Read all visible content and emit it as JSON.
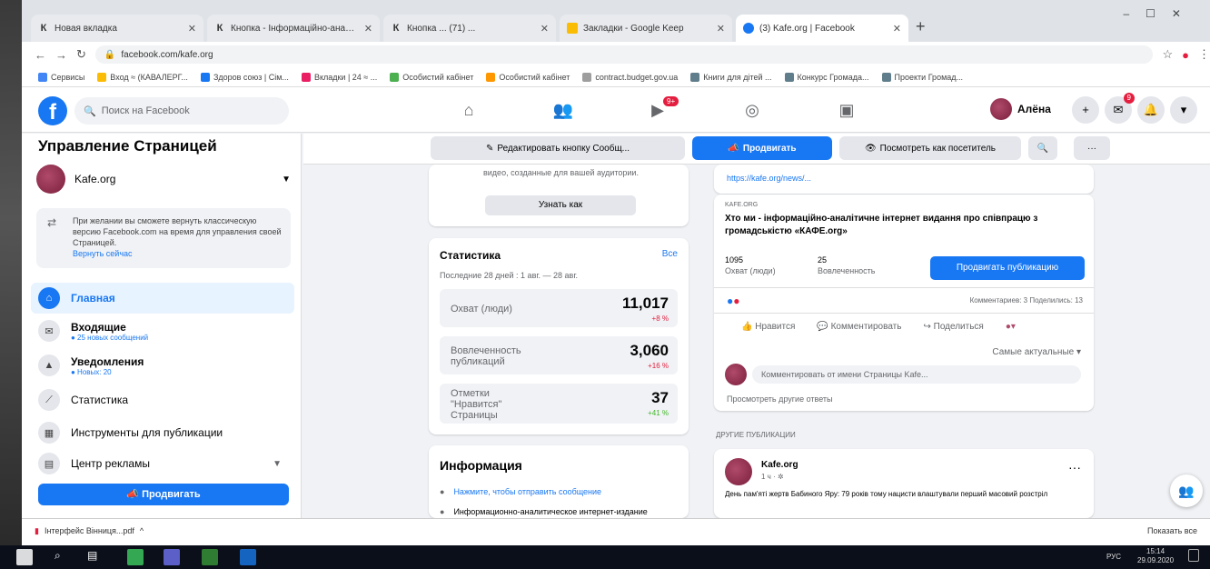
{
  "browser": {
    "tabs": [
      {
        "title": "Новая вкладка",
        "favicon": "К",
        "active": false
      },
      {
        "title": "Кнопка - Інформаційно-аналіт...",
        "favicon": "К",
        "active": false
      },
      {
        "title": "Кнопка ... (71) ...",
        "favicon": "К",
        "active": false
      },
      {
        "title": "Закладки - Google Keep",
        "favicon": "",
        "active": false
      },
      {
        "title": "(3) Kafe.org | Facebook",
        "favicon": "",
        "active": true
      }
    ],
    "new_tab": "+",
    "url": "facebook.com/kafe.org",
    "bookmarks": [
      {
        "label": "Сервисы",
        "color": "#4285f4"
      },
      {
        "label": "Вход ≈ (КАВАЛЕРГ...",
        "color": "#fbbc05"
      },
      {
        "label": "Здоров союз | Сім...",
        "color": "#1877f2"
      },
      {
        "label": "Вкладки | 24 ≈ ...",
        "color": "#e91e63"
      },
      {
        "label": "Особистий кабінет",
        "color": "#4caf50"
      },
      {
        "label": "Особистий кабінет",
        "color": "#ff9800"
      },
      {
        "label": "contract.budget.gov.ua",
        "color": "#9e9e9e"
      },
      {
        "label": "Книги для дітей ...",
        "color": "#607d8b"
      },
      {
        "label": "Конкурс Громада...",
        "color": "#607d8b"
      },
      {
        "label": "Проекти Громад...",
        "color": "#607d8b"
      }
    ]
  },
  "fbnav": {
    "search_placeholder": "Поиск на Facebook",
    "watch_badge": "9+",
    "profile_name": "Алёна",
    "notif_badge": "9"
  },
  "sidebar": {
    "title": "Управление Страницей",
    "page_name": "Kafe.org",
    "notice_text": "При желании вы сможете вернуть классическую версию Facebook.com на время для управления своей Страницей.",
    "notice_link": "Вернуть сейчас",
    "items": [
      {
        "label": "Главная",
        "sub": ""
      },
      {
        "label": "Входящие",
        "sub": "● 25 новых сообщений"
      },
      {
        "label": "Уведомления",
        "sub": "● Новых: 20"
      },
      {
        "label": "Статистика",
        "sub": ""
      },
      {
        "label": "Инструменты для публикации",
        "sub": ""
      },
      {
        "label": "Центр рекламы",
        "sub": ""
      }
    ],
    "promote_label": "Продвигать"
  },
  "actionbar": {
    "edit_button": "Редактировать кнопку Сообщ...",
    "promote_button": "Продвигать",
    "view_as_visitor": "Посмотреть как посетитель"
  },
  "left_col": {
    "prev_text": "видео, созданные для вашей аудитории.",
    "create_ad": "Узнать как",
    "stats_title": "Статистика",
    "stats_link": "Все",
    "stats_period": "Последние 28 дней : 1 авг. — 28 авг.",
    "stats": [
      {
        "label": "Охват (люди)",
        "value": "11,017",
        "change": "+8 %",
        "color": "#e41e3f"
      },
      {
        "label": "Вовлеченность публикаций",
        "value": "3,060",
        "change": "+16 %",
        "color": "#e41e3f"
      },
      {
        "label": "Отметки \"Нравится\" Страницы",
        "value": "37",
        "change": "+41 %",
        "color": "#42b72a"
      }
    ],
    "info_title": "Информация",
    "info_items": [
      "Нажмите, чтобы отправить сообщение",
      "Информационно-аналитическое интернет-издание"
    ]
  },
  "right_col": {
    "link_url": "https://kafe.org/news/...",
    "link_source": "KAFE.ORG",
    "link_title": "Хто ми - інформаційно-аналітичне інтернет видання про співпрацю з громадськістю «КАФЕ.org»",
    "reach_value": "1095",
    "reach_label": "Охват (люди)",
    "engage_value": "25",
    "engage_label": "Вовлеченность",
    "boost_button": "Продвигать публикацию",
    "reactions_meta": "Комментариев: 3  Поделились: 13",
    "like": "Нравится",
    "comment": "Комментировать",
    "share": "Поделиться",
    "sort_label": "Самые актуальные ▾",
    "comment_placeholder": "Комментировать от имени Страницы Kafe...",
    "more_comments": "Просмотреть другие ответы",
    "other_posts": "ДРУГИЕ ПУБЛИКАЦИИ",
    "post_author": "Kafe.org",
    "post_meta": "1 ч · ✲",
    "post_text": "День пам'яті жертв Бабиного Яру: 79 років тому нацисти влаштували перший масовий розстріл"
  },
  "status": {
    "download": "Інтерфейс Вінниця...pdf",
    "show_all": "Показать все"
  },
  "taskbar": {
    "lang": "РУС",
    "time": "15:14",
    "date": "29.09.2020"
  }
}
